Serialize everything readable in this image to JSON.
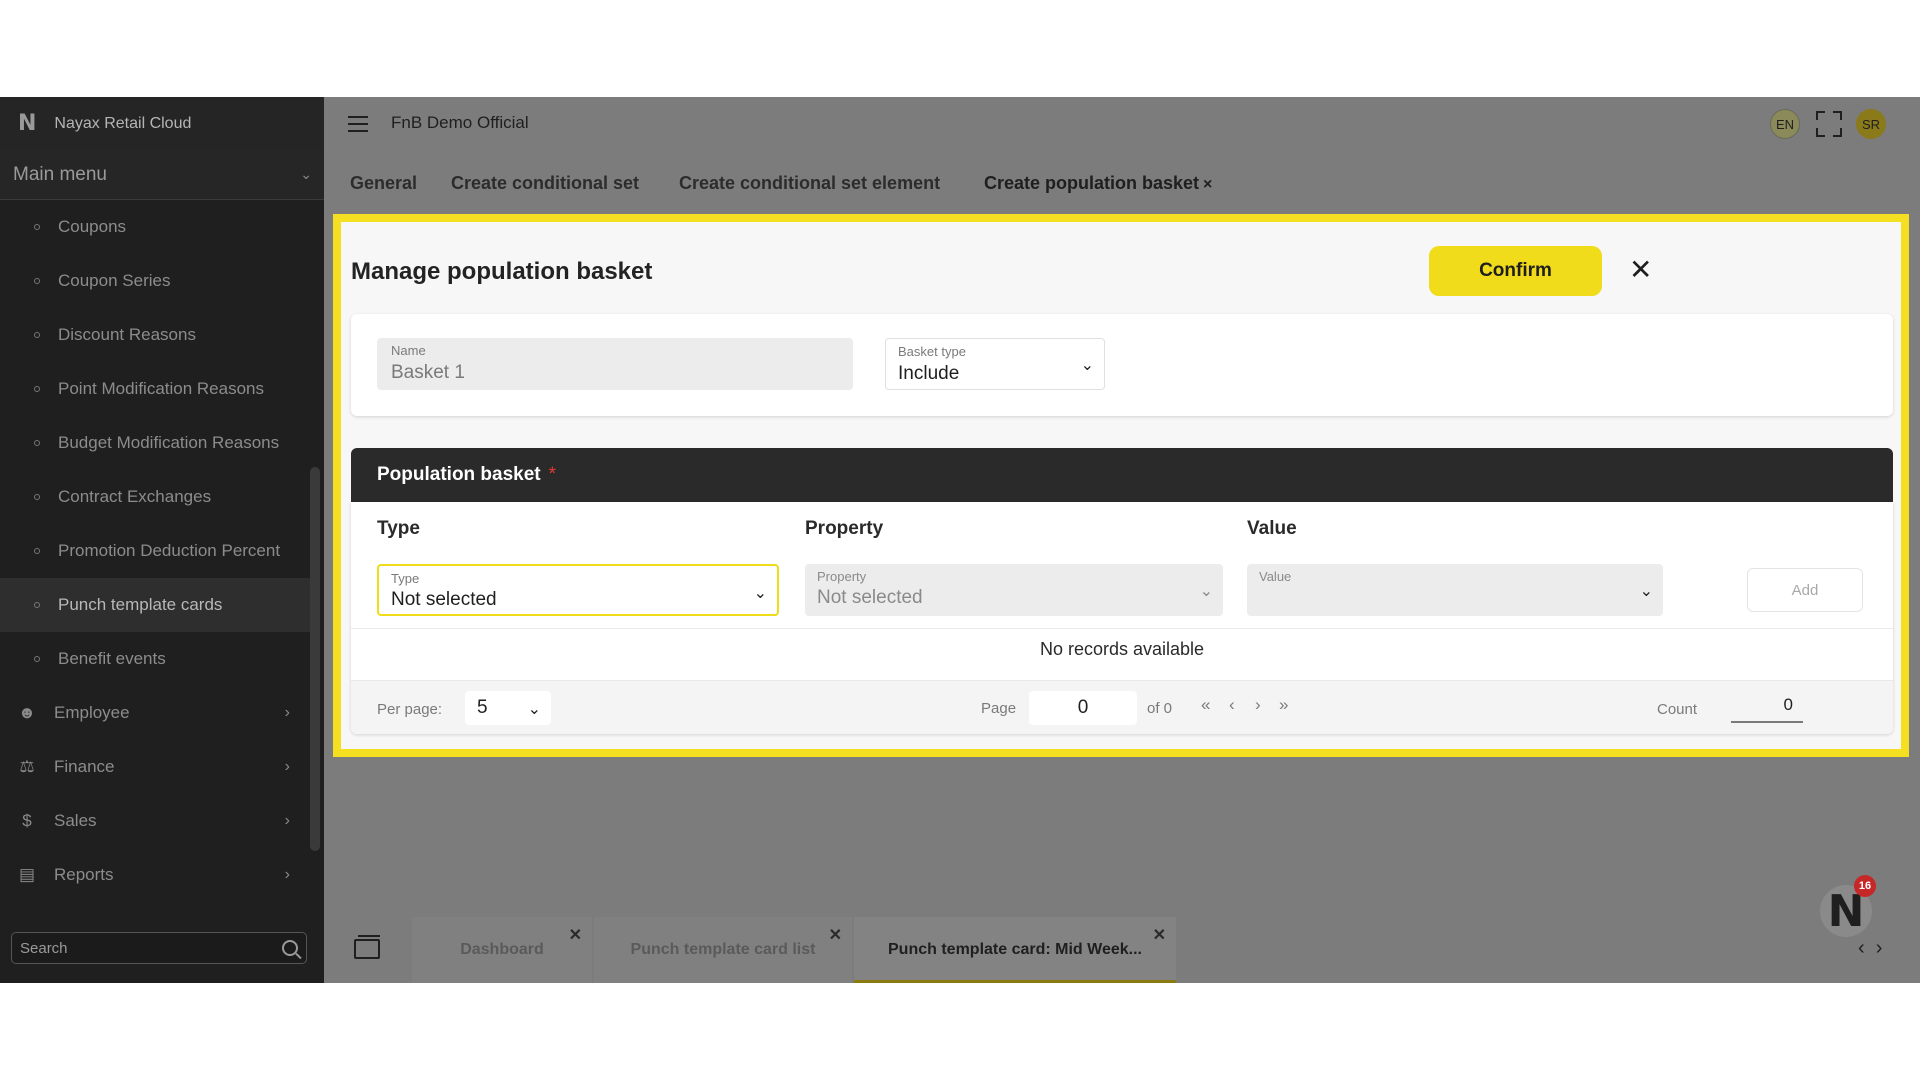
{
  "app": {
    "brand_logo": "N",
    "brand_name": "Nayax Retail Cloud",
    "company": "FnB Demo Official"
  },
  "sidebar": {
    "main_menu_label": "Main menu",
    "items": [
      {
        "label": "Coupons"
      },
      {
        "label": "Coupon Series"
      },
      {
        "label": "Discount Reasons"
      },
      {
        "label": "Point Modification Reasons"
      },
      {
        "label": "Budget Modification Reasons"
      },
      {
        "label": "Contract Exchanges"
      },
      {
        "label": "Promotion Deduction Percent"
      },
      {
        "label": "Punch template cards",
        "active": true
      },
      {
        "label": "Benefit events"
      }
    ],
    "groups": [
      {
        "label": "Employee",
        "icon": "person-icon"
      },
      {
        "label": "Finance",
        "icon": "finance-icon"
      },
      {
        "label": "Sales",
        "icon": "sales-icon"
      },
      {
        "label": "Reports",
        "icon": "reports-icon"
      }
    ],
    "search_placeholder": "Search"
  },
  "header": {
    "language": "EN",
    "user_initials": "SR"
  },
  "tabs": [
    {
      "label": "General"
    },
    {
      "label": "Create conditional set"
    },
    {
      "label": "Create conditional set element"
    },
    {
      "label": "Create population basket",
      "close": "×",
      "active": true
    }
  ],
  "dialog": {
    "title": "Manage population basket",
    "confirm_label": "Confirm",
    "close_glyph": "✕",
    "name_field": {
      "label": "Name",
      "value": "Basket 1"
    },
    "basket_type": {
      "label": "Basket type",
      "value": "Include"
    },
    "population": {
      "title": "Population basket",
      "required_mark": "*",
      "columns": [
        "Type",
        "Property",
        "Value"
      ],
      "type_select": {
        "label": "Type",
        "value": "Not selected"
      },
      "property_select": {
        "label": "Property",
        "value": "Not selected"
      },
      "value_select": {
        "label": "Value",
        "value": ""
      },
      "add_label": "Add",
      "empty_text": "No records available",
      "per_page_label": "Per page:",
      "per_page_value": "5",
      "page_label": "Page",
      "page_value": "0",
      "of_label": "of 0",
      "count_label": "Count",
      "count_value": "0"
    }
  },
  "bottom_tabs": [
    {
      "label": "Dashboard"
    },
    {
      "label": "Punch template card list"
    },
    {
      "label": "Punch template card: Mid Week...",
      "active": true
    }
  ],
  "notification_count": "16",
  "colors": {
    "accent": "#f0dc1a",
    "sidebar_bg": "#1f1f1f",
    "overlay": "#7c7c7c",
    "required": "#e53935"
  }
}
